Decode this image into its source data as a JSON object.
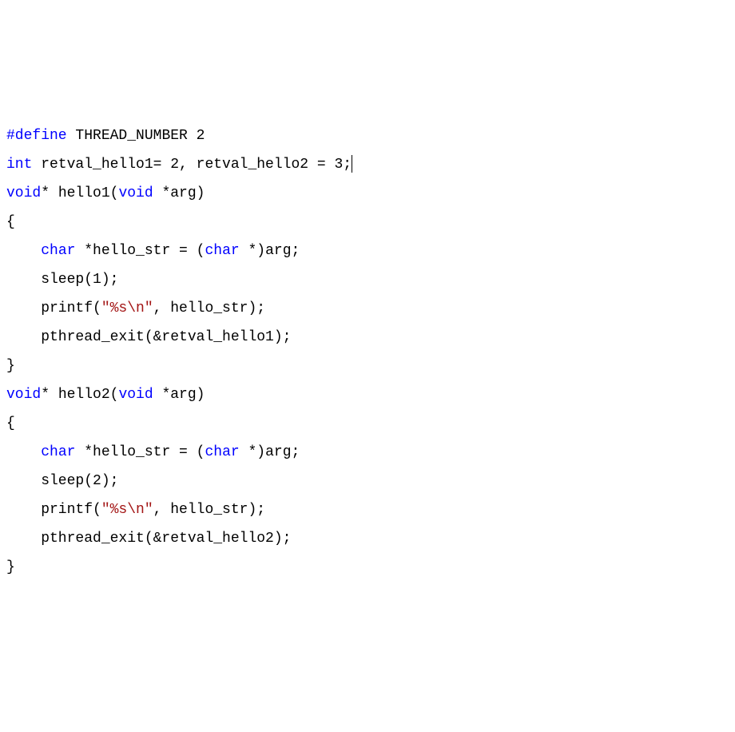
{
  "code": {
    "l1_preproc": "#define",
    "l1_rest": " THREAD_NUMBER 2",
    "l2_kw_int": "int",
    "l2_rest": " retval_hello1= 2, retval_hello2 = 3;",
    "l3_kw_void1": "void",
    "l3_star": "* hello1(",
    "l3_kw_void2": "void",
    "l3_rest": " *arg)",
    "l4": "{",
    "l5_indent": "    ",
    "l5_kw_char1": "char",
    "l5_mid": " *hello_str = (",
    "l5_kw_char2": "char",
    "l5_rest": " *)arg;",
    "l6": "    sleep(1);",
    "l7_a": "    printf(",
    "l7_str": "\"%s\\n\"",
    "l7_b": ", hello_str);",
    "l8": "    pthread_exit(&retval_hello1);",
    "l9": "}",
    "l10_kw_void1": "void",
    "l10_star": "* hello2(",
    "l10_kw_void2": "void",
    "l10_rest": " *arg)",
    "l11": "{",
    "l12_indent": "    ",
    "l12_kw_char1": "char",
    "l12_mid": " *hello_str = (",
    "l12_kw_char2": "char",
    "l12_rest": " *)arg;",
    "l13": "    sleep(2);",
    "l14_a": "    printf(",
    "l14_str": "\"%s\\n\"",
    "l14_b": ", hello_str);",
    "l15": "    pthread_exit(&retval_hello2);",
    "l16": "}"
  }
}
